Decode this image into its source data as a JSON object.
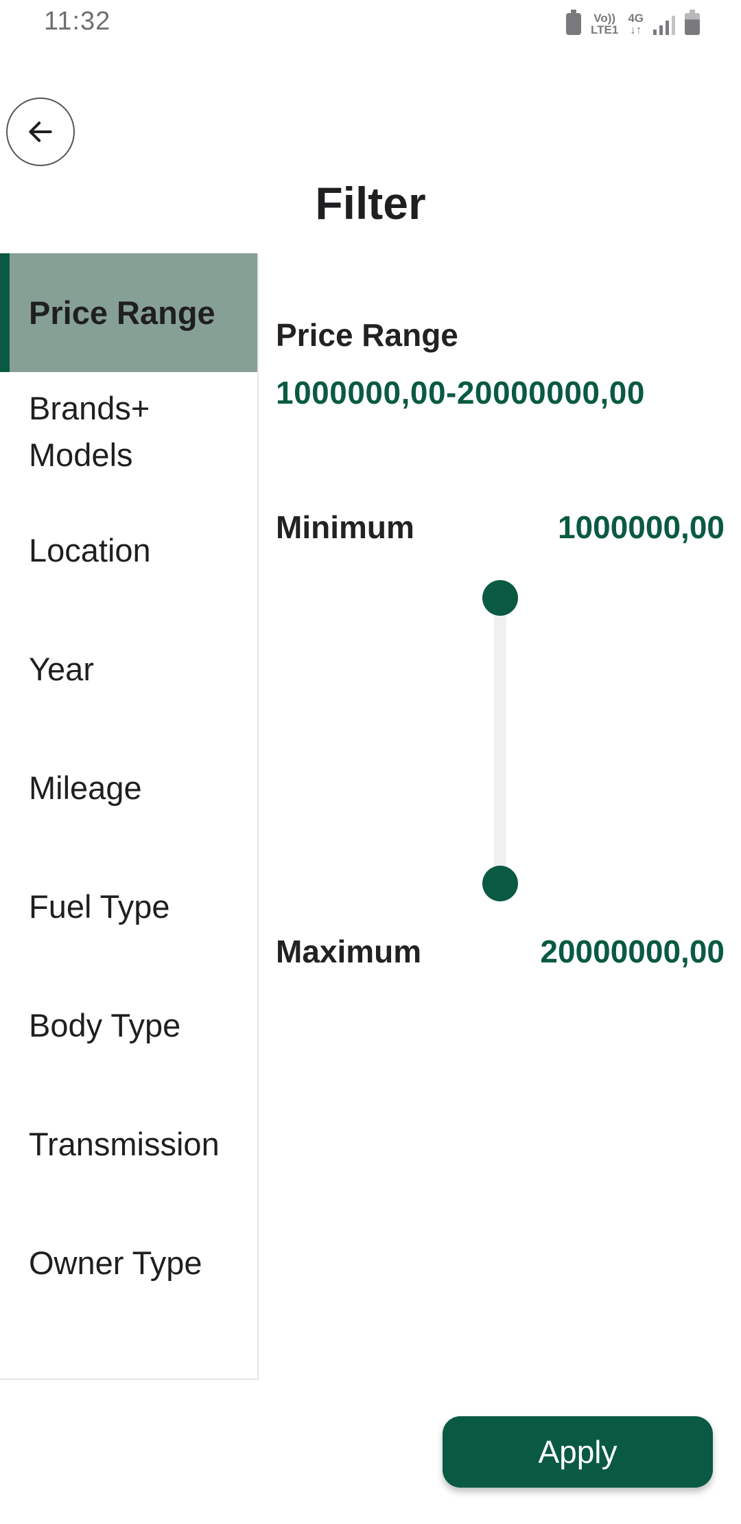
{
  "status_bar": {
    "time": "11:32",
    "volte_line1": "Vo))",
    "volte_line2": "LTE1",
    "network": "4G",
    "icons": [
      "battery-saver-icon",
      "signal-icon",
      "battery-icon"
    ]
  },
  "header": {
    "back_icon": "arrow-left-icon",
    "title": "Filter"
  },
  "sidebar": {
    "items": [
      {
        "label": "Price Range",
        "active": true
      },
      {
        "label": "Brands+ Models",
        "active": false
      },
      {
        "label": "Location",
        "active": false
      },
      {
        "label": "Year",
        "active": false
      },
      {
        "label": "Mileage",
        "active": false
      },
      {
        "label": "Fuel Type",
        "active": false
      },
      {
        "label": "Body Type",
        "active": false
      },
      {
        "label": "Transmission",
        "active": false
      },
      {
        "label": "Owner Type",
        "active": false
      }
    ]
  },
  "panel": {
    "title": "Price Range",
    "range_text": "1000000,00-20000000,00",
    "minimum_label": "Minimum",
    "minimum_value": "1000000,00",
    "maximum_label": "Maximum",
    "maximum_value": "20000000,00"
  },
  "actions": {
    "apply_label": "Apply"
  },
  "colors": {
    "accent": "#0a5a43",
    "active_item_bg": "#87a096",
    "slider_track": "#f0f0f0"
  }
}
